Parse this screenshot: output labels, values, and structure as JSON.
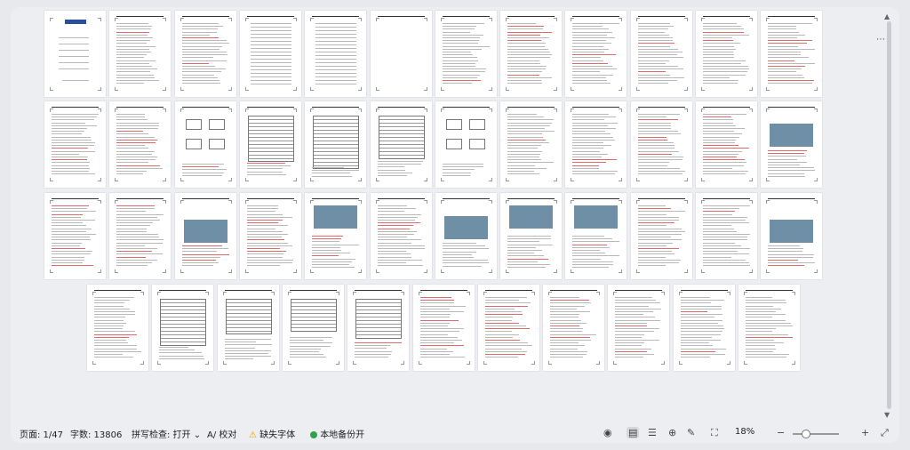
{
  "status": {
    "page": "页面: 1/47",
    "words": "字数: 13806",
    "spell": "拼写检查: 打开",
    "proof": "校对",
    "missing_font": "缺失字体",
    "backup": "本地备份开",
    "zoom": "18%"
  },
  "icons": {
    "spell_caret": "⌄",
    "proof": "A/",
    "missing_font": "⚠",
    "eye": "◉",
    "page_view": "▤",
    "outline": "☰",
    "web": "⊕",
    "pen": "✎",
    "fit": "⛶",
    "minus": "−",
    "plus": "+",
    "fullscreen": "⤢",
    "more": "⋯",
    "scroll_up": "▲",
    "scroll_down": "▼"
  },
  "colors": {
    "accent_warning": "#e5a000",
    "accent_ok": "#2fa34a",
    "redline": "#e06a6a"
  },
  "document": {
    "page_count": 47,
    "cover_school_label": ""
  }
}
